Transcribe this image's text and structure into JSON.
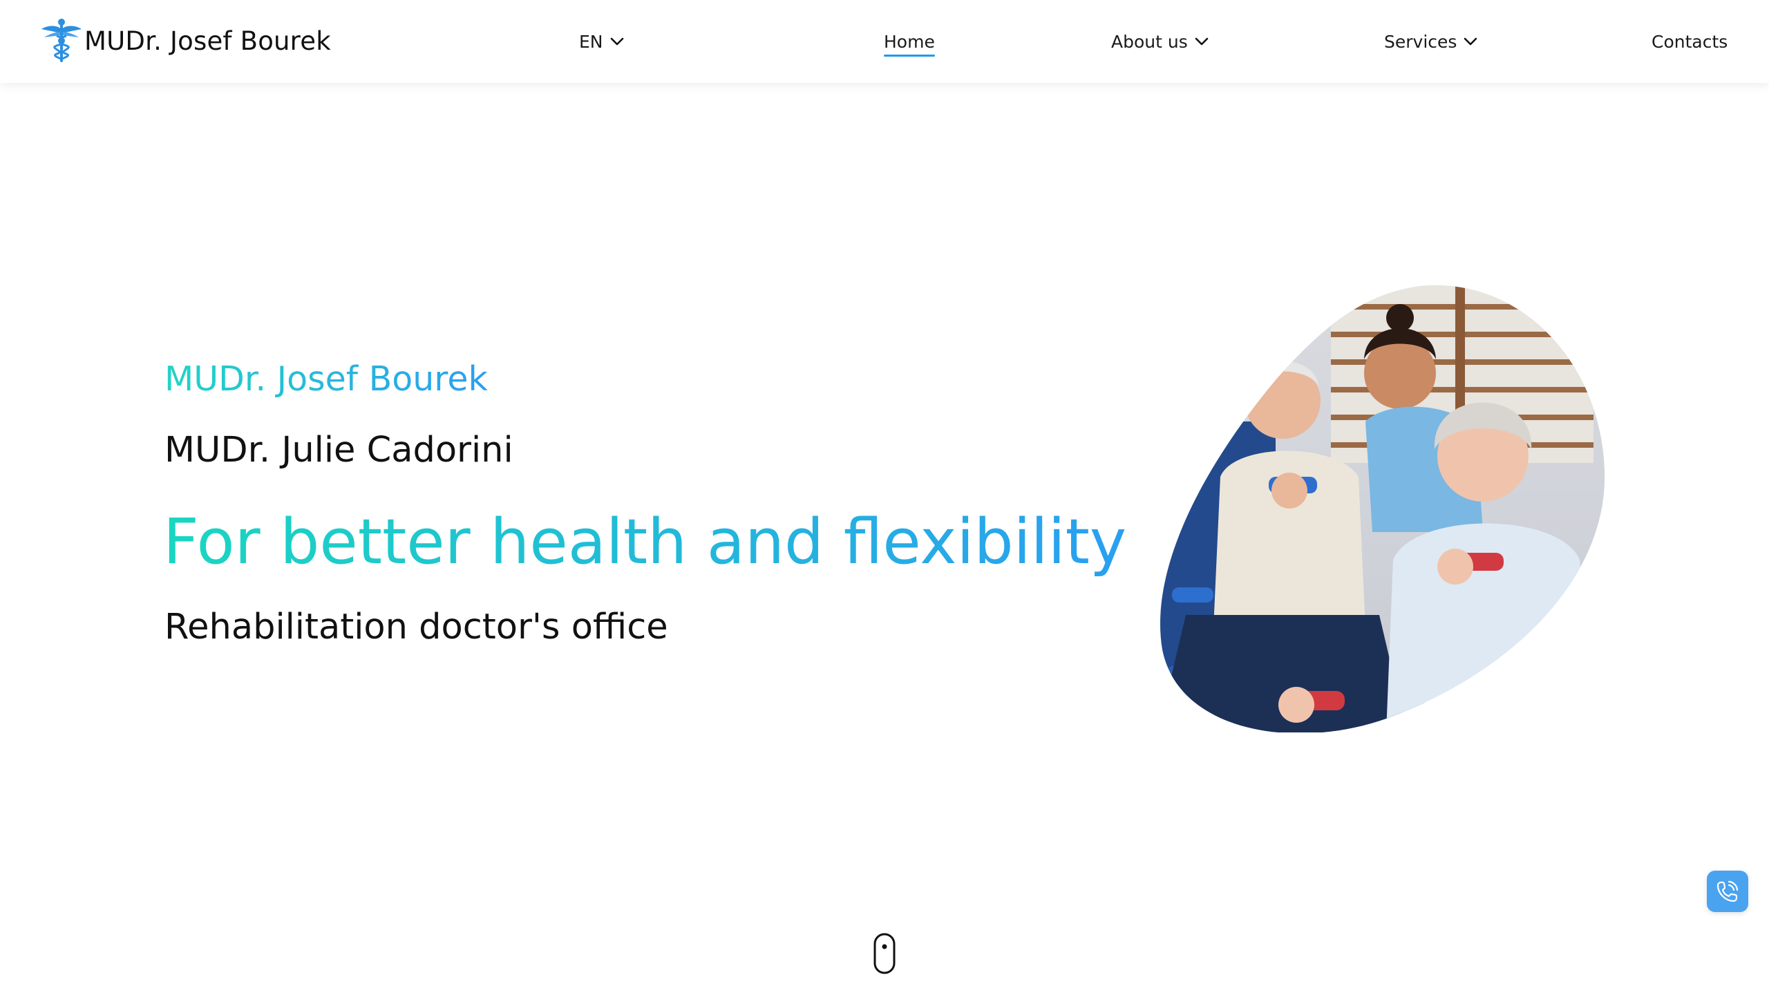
{
  "header": {
    "brand": {
      "name": "MUDr. Josef Bourek",
      "logo_icon": "caduceus-icon"
    },
    "nav": {
      "language": {
        "label": "EN",
        "icon": "chevron-down-icon"
      },
      "home": {
        "label": "Home",
        "active": true
      },
      "about": {
        "label": "About us",
        "icon": "chevron-down-icon"
      },
      "services": {
        "label": "Services",
        "icon": "chevron-down-icon"
      },
      "contacts": {
        "label": "Contacts"
      }
    }
  },
  "hero": {
    "kicker": "MUDr. Josef Bourek",
    "subtitle": "MUDr. Julie Cadorini",
    "title": "For better health and flexibility",
    "tagline": "Rehabilitation doctor's office"
  },
  "floating": {
    "call_icon": "phone-call-icon"
  },
  "scroll": {
    "icon": "mouse-scroll-icon"
  },
  "colors": {
    "accent_teal": "#1ad6c0",
    "accent_blue": "#2a9ff0",
    "nav_underline": "#1e9be5",
    "call_button": "#4aa3ef"
  }
}
